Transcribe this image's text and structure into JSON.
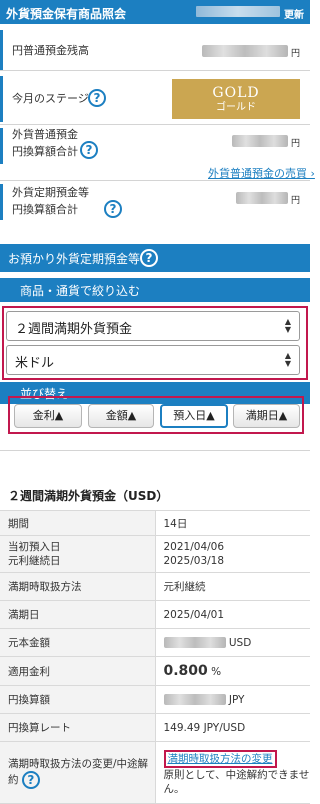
{
  "header": {
    "title": "外貨預金保有商品照会",
    "update": "更新"
  },
  "summary": {
    "yen_balance_label": "円普通預金残高",
    "currency_unit": "円",
    "stage_label": "今月のステージ",
    "gold_badge": {
      "main": "GOLD",
      "sub": "ゴールド"
    },
    "fx_ordinary_label_1": "外貨普通預金",
    "fx_ordinary_label_2": "円換算額合計",
    "fx_trade_link": "外貨普通預金の売買 ›",
    "fx_time_label_1": "外貨定期預金等",
    "fx_time_label_2": "円換算額合計"
  },
  "deposits_section": {
    "title": "お預かり外貨定期預金等"
  },
  "filter": {
    "title": "商品・通貨で絞り込む",
    "product_value": "２週間満期外貨預金",
    "currency_value": "米ドル",
    "select_arrow": "▲▼"
  },
  "sort": {
    "title": "並び替え",
    "buttons": [
      "金利▲",
      "金額▲",
      "預入日▲",
      "満期日▲"
    ],
    "active": "預入日▲"
  },
  "product": {
    "title": "２週間満期外貨預金（USD）",
    "rows": [
      {
        "key": "期間",
        "value": "14日"
      },
      {
        "key1": "当初預入日",
        "key2": "元利継続日",
        "value1": "2021/04/06",
        "value2": "2025/03/18"
      },
      {
        "key": "満期時取扱方法",
        "value": "元利継続"
      },
      {
        "key": "満期日",
        "value": "2025/04/01"
      },
      {
        "key": "元本金額",
        "unit": "USD"
      },
      {
        "key": "適用金利",
        "value": "0.800",
        "unit": "%"
      },
      {
        "key": "円換算額",
        "unit": "JPY"
      },
      {
        "key": "円換算レート",
        "value": "149.49 JPY/USD"
      },
      {
        "key": "満期時取扱方法の変更/中途解約",
        "link": "満期時取扱方法の変更",
        "note": "原則として、中途解約できません。"
      }
    ]
  },
  "help_icon": "?",
  "colors": {
    "brand_blue": "#1c7fc1",
    "highlight_red": "#c2184d",
    "gold": "#cba651"
  }
}
